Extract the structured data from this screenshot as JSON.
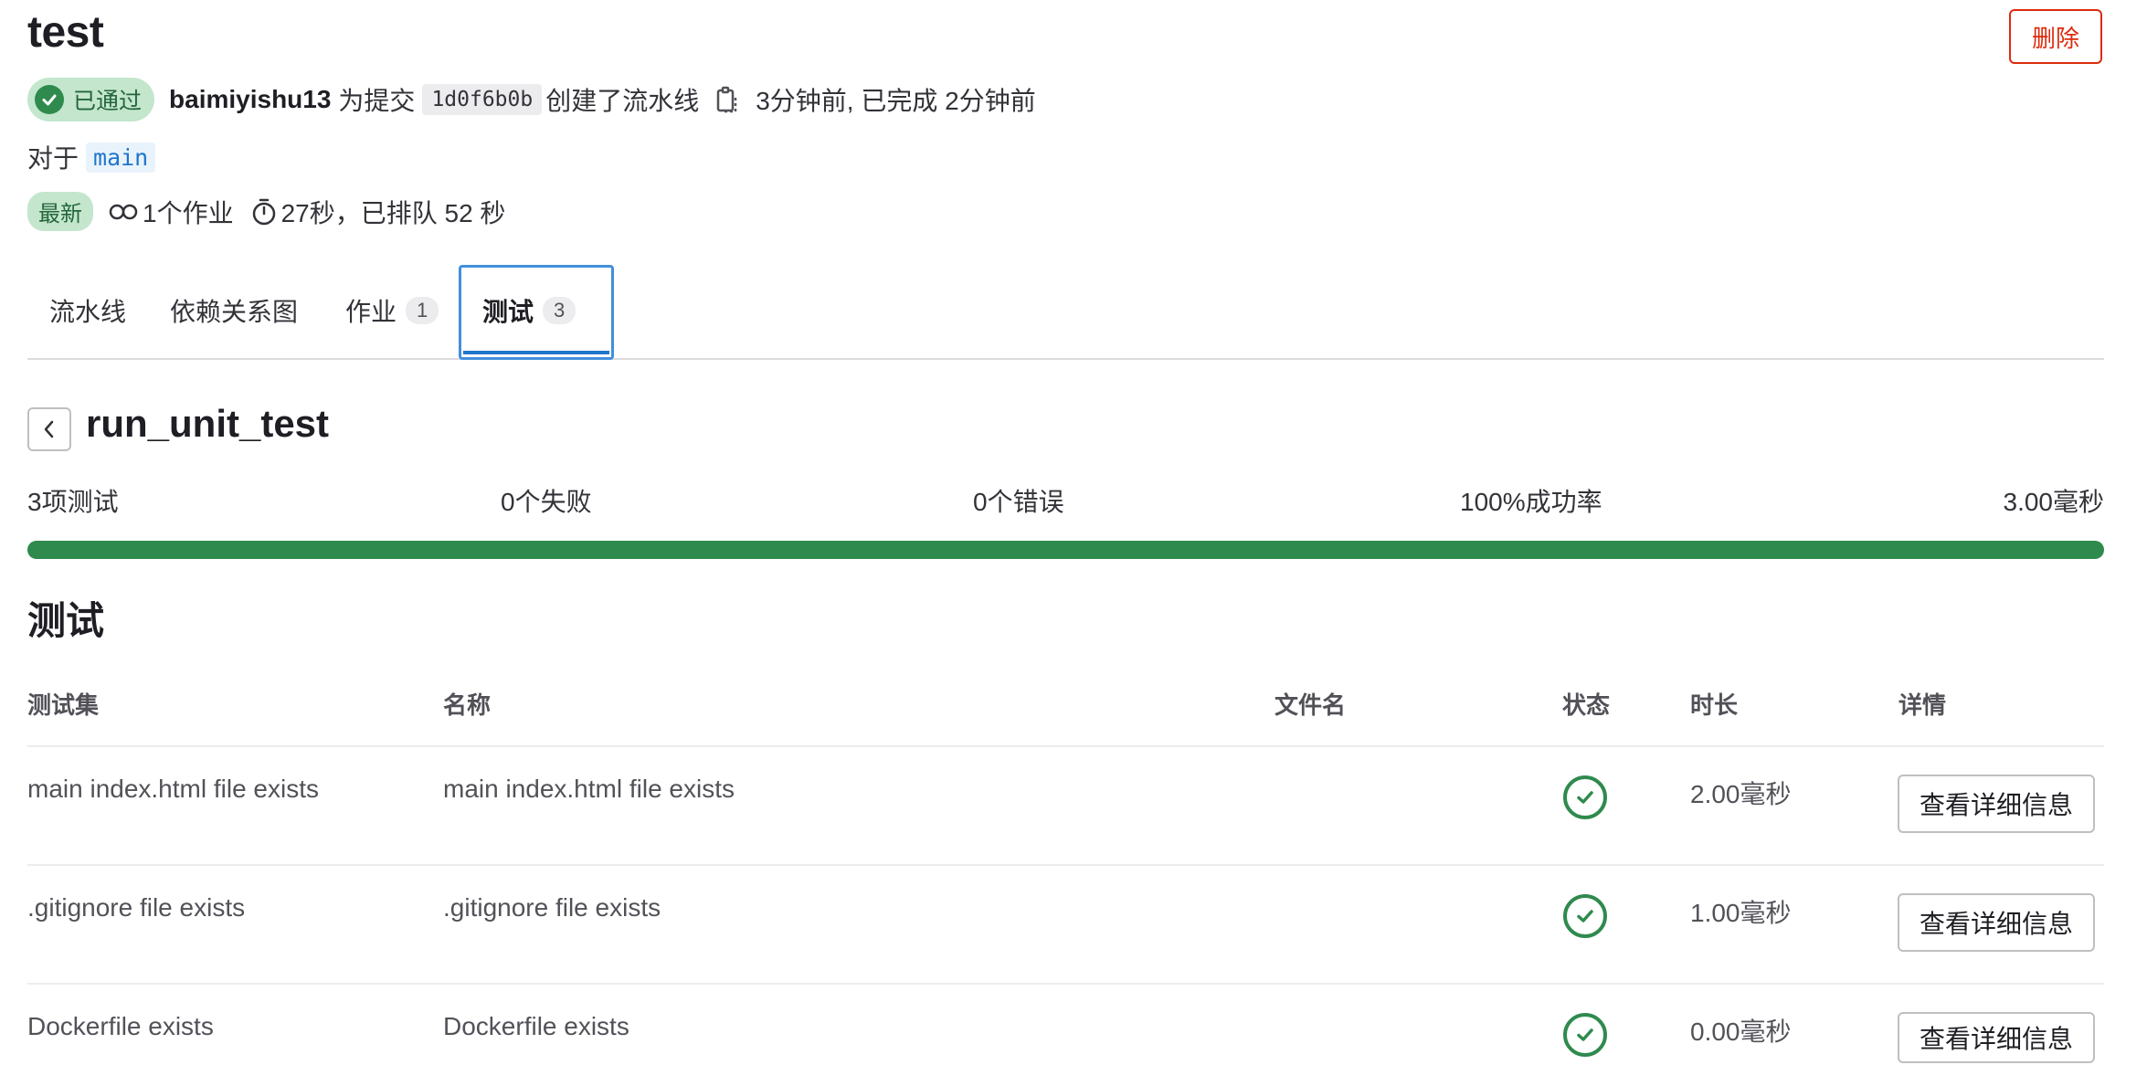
{
  "header": {
    "title": "test",
    "delete_label": "删除"
  },
  "pipeline_info": {
    "status_label": "已通过",
    "author": "baimiyishu13",
    "for_commit_text": "为提交",
    "commit_sha": "1d0f6b0b",
    "created_text": "创建了流水线",
    "timing_text": "3分钟前, 已完成 2分钟前",
    "for_text": "对于",
    "branch": "main",
    "latest_badge": "最新",
    "jobs_text": "1个作业",
    "duration_text": "27秒，已排队 52 秒"
  },
  "tabs": [
    {
      "label": "流水线",
      "count": null
    },
    {
      "label": "依赖关系图",
      "count": null
    },
    {
      "label": "作业",
      "count": "1"
    },
    {
      "label": "测试",
      "count": "3"
    }
  ],
  "suite": {
    "name": "run_unit_test",
    "stats": {
      "tests": "3项测试",
      "failures": "0个失败",
      "errors": "0个错误",
      "success_rate": "100%成功率",
      "duration": "3.00毫秒"
    },
    "progress_percent": 100,
    "success_color": "#2f8a4e"
  },
  "tests_section": {
    "title": "测试",
    "columns": {
      "suite": "测试集",
      "name": "名称",
      "filename": "文件名",
      "status": "状态",
      "duration": "时长",
      "details": "详情"
    },
    "rows": [
      {
        "suite": "main index.html file exists",
        "name": "main index.html file exists",
        "filename": "",
        "status": "success",
        "duration": "2.00毫秒",
        "details_label": "查看详细信息"
      },
      {
        "suite": ".gitignore file exists",
        "name": ".gitignore file exists",
        "filename": "",
        "status": "success",
        "duration": "1.00毫秒",
        "details_label": "查看详细信息"
      },
      {
        "suite": "Dockerfile exists",
        "name": "Dockerfile exists",
        "filename": "",
        "status": "success",
        "duration": "0.00毫秒",
        "details_label": "查看详细信息"
      }
    ]
  }
}
